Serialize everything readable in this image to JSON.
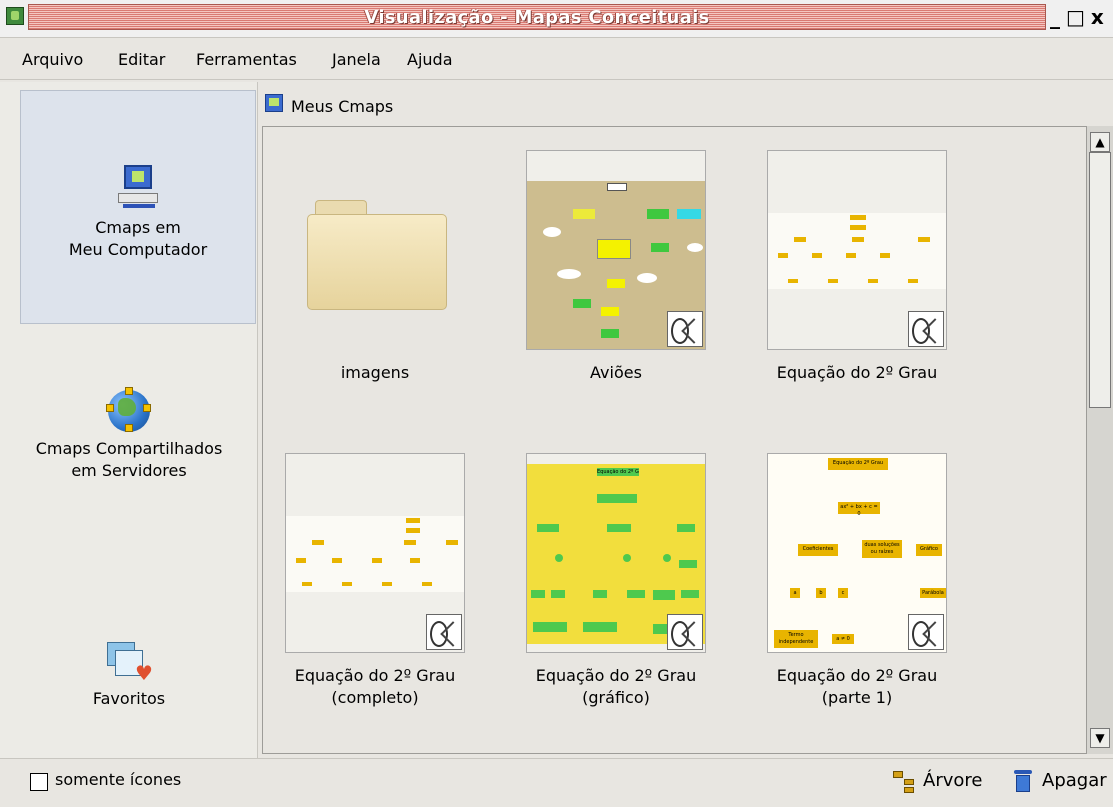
{
  "window": {
    "title": "Visualização - Mapas Conceituais",
    "controls": [
      "_",
      "□",
      "x"
    ]
  },
  "menu": [
    "Arquivo",
    "Editar",
    "Ferramentas",
    "Janela",
    "Ajuda"
  ],
  "sidebar": {
    "items": [
      {
        "line1": "Cmaps em",
        "line2": "Meu Computador",
        "icon": "computer-icon",
        "selected": true
      },
      {
        "line1": "Cmaps Compartilhados",
        "line2": "em Servidores",
        "icon": "globe-icon",
        "selected": false
      },
      {
        "line1": "Favoritos",
        "line2": "",
        "icon": "favorites-icon",
        "selected": false
      }
    ]
  },
  "content": {
    "header": "Meus Cmaps",
    "items": [
      {
        "line1": "imagens",
        "line2": "",
        "type": "folder"
      },
      {
        "line1": "Aviões",
        "line2": "",
        "type": "cmap"
      },
      {
        "line1": "Equação do 2º Grau",
        "line2": "",
        "type": "cmap"
      },
      {
        "line1": "Equação do 2º Grau",
        "line2": "(completo)",
        "type": "cmap"
      },
      {
        "line1": "Equação do 2º Grau",
        "line2": "(gráfico)",
        "type": "cmap"
      },
      {
        "line1": "Equação do 2º Grau",
        "line2": "(parte 1)",
        "type": "cmap"
      }
    ],
    "thumb_text": {
      "grafico_title": "Equação do 2º Grau",
      "part1_title": "Equação do 2º Grau",
      "part1_equation": "ax² + bx + c = 0",
      "part1_coef": "Coeficientes",
      "part1_sol": "duas soluções ou raízes",
      "part1_graf": "Gráfico",
      "part1_a": "a",
      "part1_b": "b",
      "part1_c": "c",
      "part1_parab": "Parábola",
      "part1_termo": "Termo independente",
      "part1_a0": "a ≠ 0"
    }
  },
  "bottom": {
    "checkbox_label": "somente ícones",
    "checkbox_checked": false,
    "tree_label": "Árvore",
    "delete_label": "Apagar"
  },
  "colors": {
    "title_bar": "#d97a72",
    "selected_sidebar": "#dde3ec",
    "cmap_node_yellow": "#e8b400",
    "cmap_node_green": "#4ec94e"
  }
}
